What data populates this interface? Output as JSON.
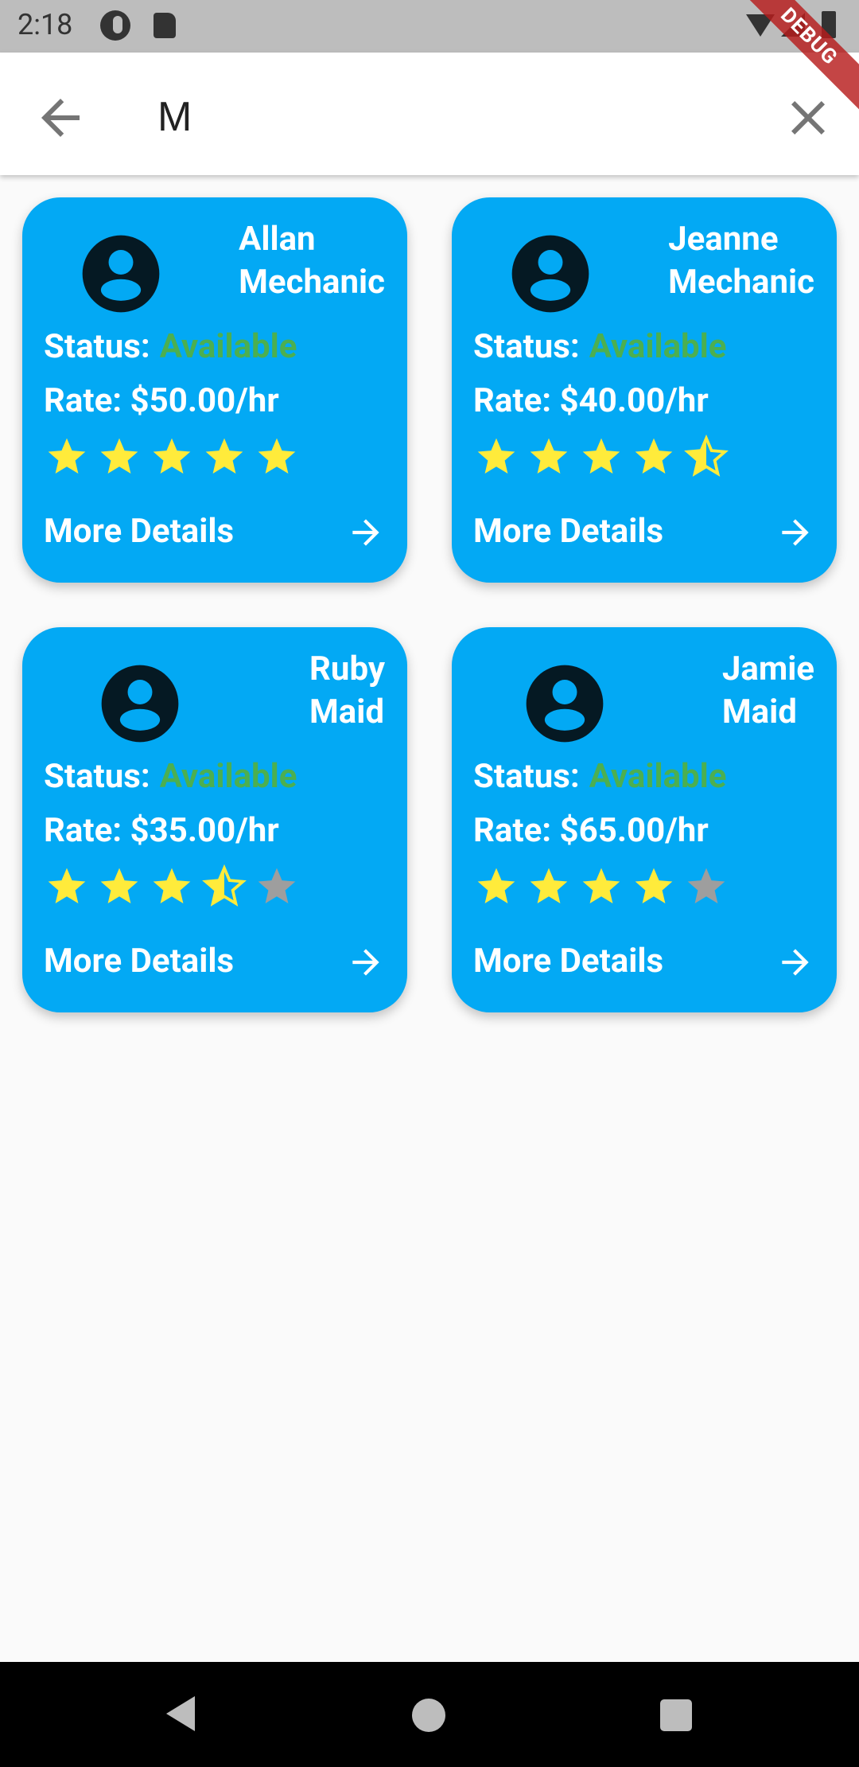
{
  "status_bar": {
    "time": "2:18"
  },
  "debug_banner": "DEBUG",
  "search": {
    "value": "M"
  },
  "cards": [
    {
      "first_name": "Allan",
      "role": "Mechanic",
      "status_label": "Status:",
      "status": "Available",
      "rate": "Rate: $50.00/hr",
      "rating": 5,
      "details_label": "More Details"
    },
    {
      "first_name": "Jeanne",
      "role": "Mechanic",
      "status_label": "Status:",
      "status": "Available",
      "rate": "Rate: $40.00/hr",
      "rating": 4.5,
      "details_label": "More Details"
    },
    {
      "first_name": "Ruby",
      "role": "Maid",
      "status_label": "Status:",
      "status": "Available",
      "rate": "Rate: $35.00/hr",
      "rating": 3.5,
      "details_label": "More Details"
    },
    {
      "first_name": "Jamie",
      "role": "Maid",
      "status_label": "Status:",
      "status": "Available",
      "rate": "Rate: $65.00/hr",
      "rating": 4,
      "details_label": "More Details"
    }
  ],
  "colors": {
    "card": "#03a9f4",
    "available": "#4caf50",
    "star_filled": "#ffeb3b",
    "star_empty": "#9e9e9e",
    "avatar": "#051923"
  }
}
